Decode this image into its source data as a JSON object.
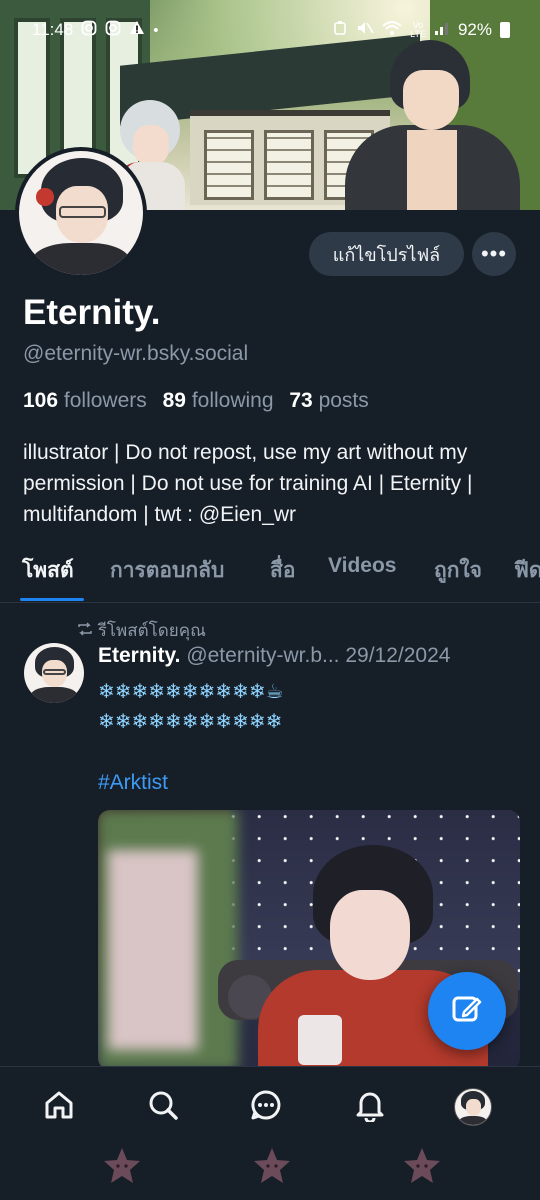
{
  "status_bar": {
    "time": "11:48",
    "left_icons": [
      "instagram-icon",
      "instagram-icon",
      "warning-icon",
      "dot-icon"
    ],
    "battery": "92%",
    "right_icons": [
      "alarm-icon",
      "mute-icon",
      "wifi-icon",
      "volte-icon",
      "signal-icon",
      "battery-icon"
    ]
  },
  "profile": {
    "edit_label": "แก้ไขโปรไฟล์",
    "more_label": "•••",
    "display_name": "Eternity.",
    "handle": "@eternity-wr.bsky.social",
    "stats": {
      "followers_count": "106",
      "followers_label": "followers",
      "following_count": "89",
      "following_label": "following",
      "posts_count": "73",
      "posts_label": "posts"
    },
    "bio": "illustrator | Do not repost, use my art without my permission | Do not use for training AI | Eternity | multifandom | twt : @Eien_wr"
  },
  "tabs": [
    {
      "label": "โพสต์",
      "active": true
    },
    {
      "label": "การตอบกลับ",
      "active": false
    },
    {
      "label": "สื่อ",
      "active": false
    },
    {
      "label": "Videos",
      "active": false
    },
    {
      "label": "ถูกใจ",
      "active": false
    },
    {
      "label": "ฟีด",
      "active": false
    }
  ],
  "post": {
    "repost_label": "รีโพสต์โดยคุณ",
    "author_name": "Eternity.",
    "author_handle": "@eternity-wr.b...",
    "date": "29/12/2024",
    "line1": "❄❄❄❄❄❄❄❄❄❄☕",
    "line2": "❄❄❄❄❄❄❄❄❄❄❄",
    "hashtag": "#Arktist"
  },
  "colors": {
    "background": "#161e27",
    "accent": "#1d84f2",
    "muted_text": "#8b98a8",
    "button_bg": "#2e3a48"
  },
  "bottom_nav": [
    "home-icon",
    "search-icon",
    "chat-icon",
    "bell-icon",
    "profile-avatar"
  ]
}
